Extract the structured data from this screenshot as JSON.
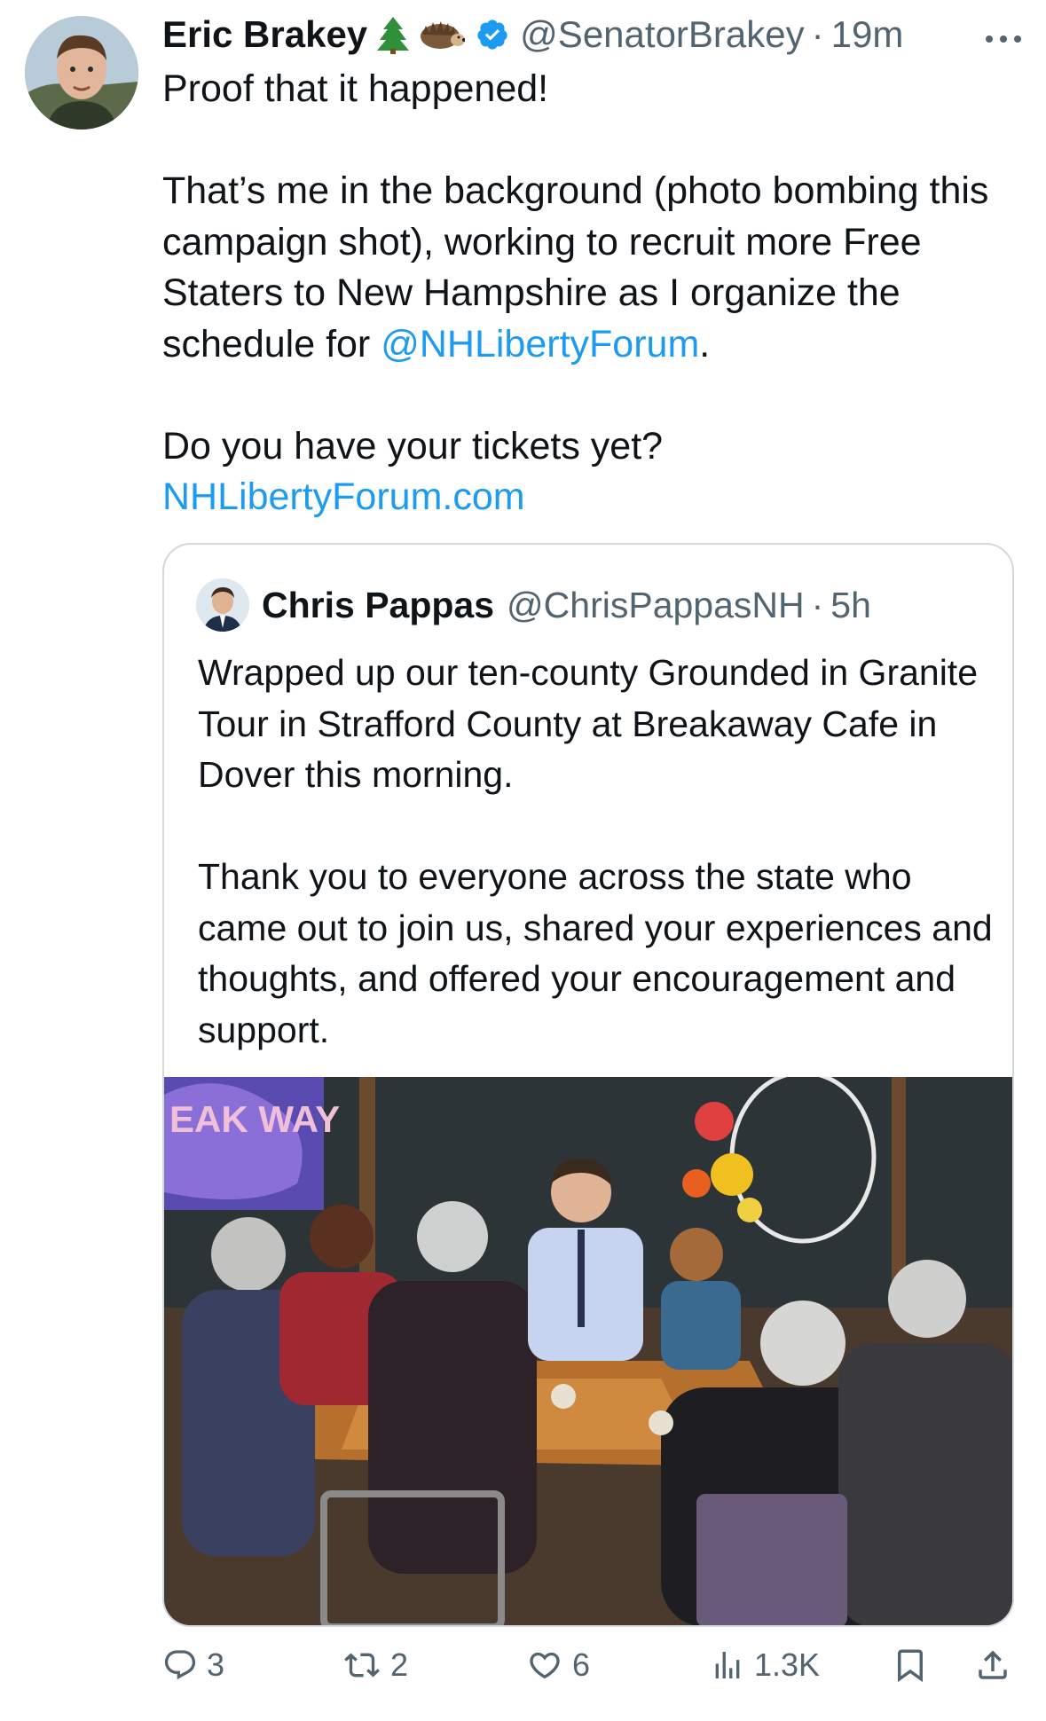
{
  "tweet": {
    "author_name": "Eric Brakey",
    "handle": "@SenatorBrakey",
    "separator": "·",
    "time": "19m",
    "emoji_icons": [
      "evergreen-tree-icon",
      "hedgehog-icon"
    ],
    "body": {
      "line1": "Proof that it happened!",
      "para2": "That’s me in the background (photo bombing this campaign shot), working to recruit more Free Staters to New Hampshire as I organize the schedule for ",
      "mention": "@NHLibertyForum",
      "para2_end": ".",
      "para3": "Do you have your tickets yet?",
      "link": "NHLibertyForum.com"
    }
  },
  "quoted": {
    "author_name": "Chris Pappas",
    "handle": "@ChrisPappasNH",
    "separator": "·",
    "time": "5h",
    "para1": "Wrapped up our ten-county Grounded in Granite Tour in Strafford County at Breakaway Cafe in Dover this morning.",
    "para2": "Thank you to everyone across the state who came out to join us, shared your experiences and thoughts, and offered your encouragement and support.",
    "photo_sign_text": "EAK WAY"
  },
  "actions": {
    "replies": "3",
    "retweets": "2",
    "likes": "6",
    "views": "1.3K"
  },
  "colors": {
    "accent": "#1d9bf0",
    "secondary_text": "#536471",
    "border": "#cfd9de"
  }
}
